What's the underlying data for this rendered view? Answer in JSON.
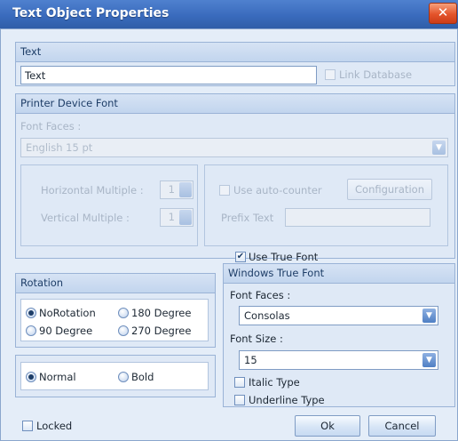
{
  "window": {
    "title": "Text Object Properties",
    "close_glyph": "✕"
  },
  "text_group": {
    "header": "Text",
    "value": "Text",
    "link_database_label": "Link Database",
    "link_database_checked": false
  },
  "printer_group": {
    "header": "Printer Device Font",
    "font_faces_label": "Font Faces :",
    "font_faces_value": "English 15 pt",
    "horizontal_multiple_label": "Horizontal Multiple :",
    "horizontal_multiple_value": "1",
    "vertical_multiple_label": "Vertical Multiple :",
    "vertical_multiple_value": "1",
    "auto_counter_label": "Use auto-counter",
    "auto_counter_checked": false,
    "configuration_label": "Configuration",
    "prefix_text_label": "Prefix Text"
  },
  "rotation_group": {
    "header": "Rotation",
    "options": [
      {
        "label": "NoRotation",
        "selected": true
      },
      {
        "label": "180 Degree",
        "selected": false
      },
      {
        "label": "90 Degree",
        "selected": false
      },
      {
        "label": "270 Degree",
        "selected": false
      }
    ]
  },
  "style_group": {
    "options": [
      {
        "label": "Normal",
        "selected": true
      },
      {
        "label": "Bold",
        "selected": false
      }
    ]
  },
  "true_font": {
    "use_true_font_label": "Use True Font",
    "use_true_font_checked": true,
    "header": "Windows True Font",
    "font_faces_label": "Font Faces :",
    "font_faces_value": "Consolas",
    "font_size_label": "Font Size :",
    "font_size_value": "15",
    "italic_label": "Italic Type",
    "italic_checked": false,
    "underline_label": "Underline Type",
    "underline_checked": false
  },
  "footer": {
    "locked_label": "Locked",
    "locked_checked": false,
    "ok_label": "Ok",
    "cancel_label": "Cancel"
  },
  "icons": {
    "check_glyph": "✔",
    "dropdown_glyph": "▼"
  },
  "colors": {
    "titlebar": "#3a6bbd",
    "close_button": "#e4532a",
    "panel_background": "#e4edf8",
    "group_header": "#c2d5ee"
  }
}
